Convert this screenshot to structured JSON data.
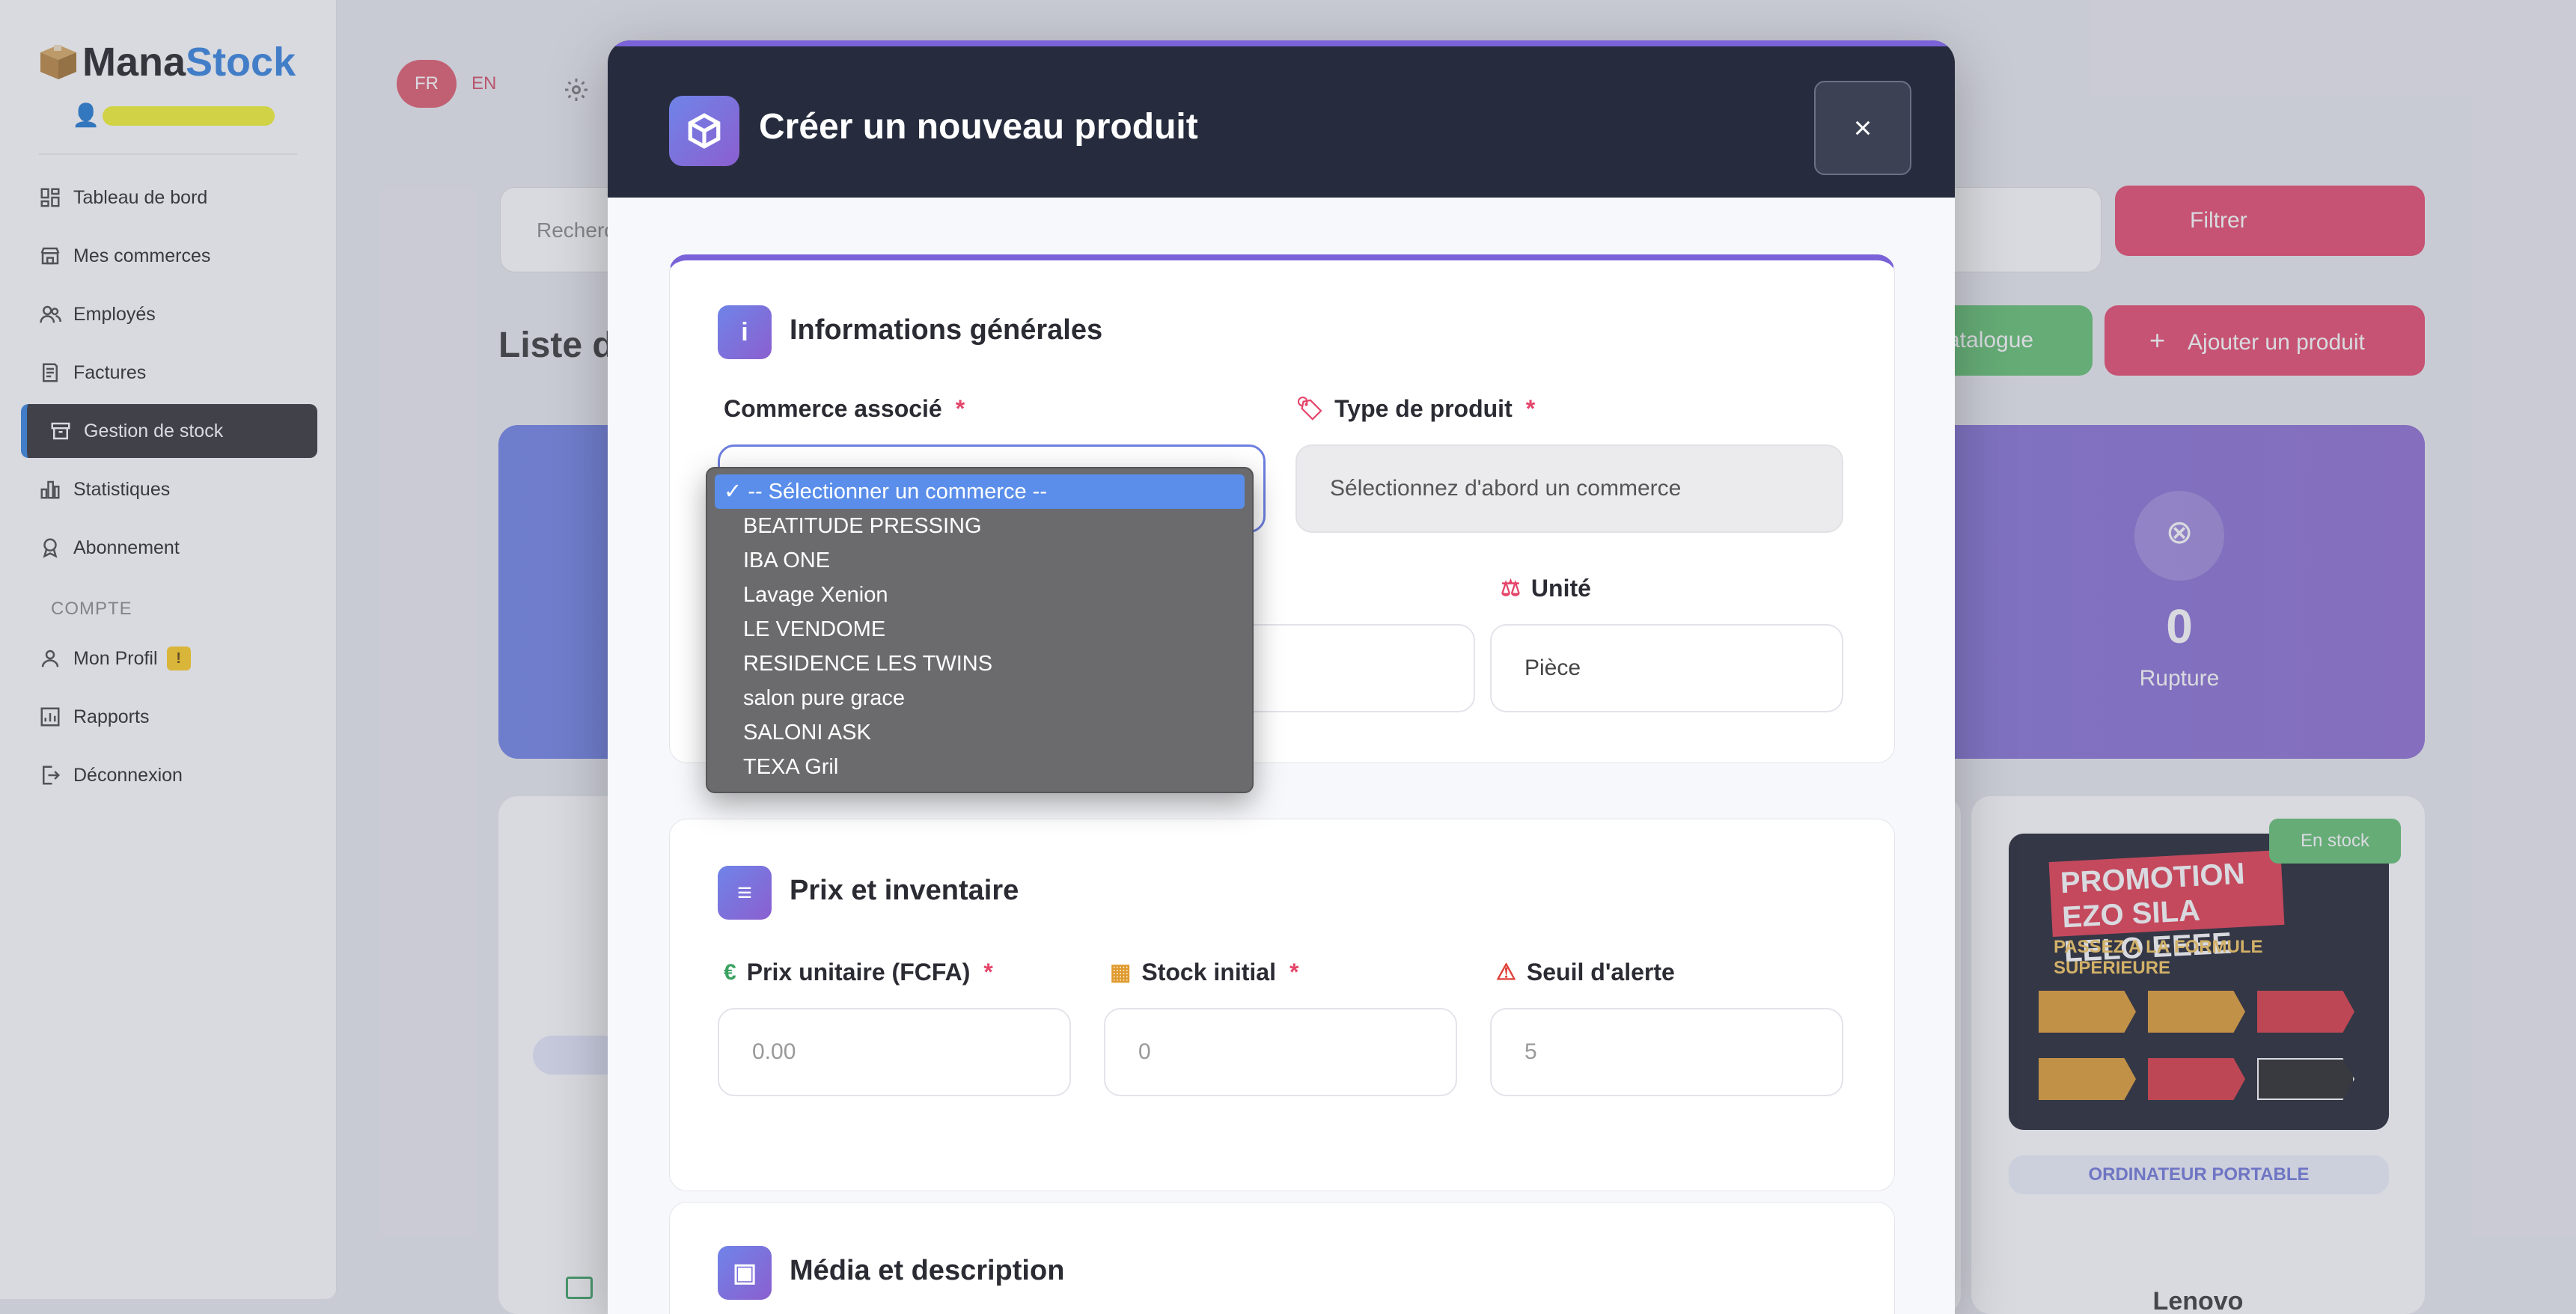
{
  "app": {
    "brand_part1": "Mana",
    "brand_part2": "Stock"
  },
  "sidebar": {
    "items": [
      {
        "label": "Tableau de bord"
      },
      {
        "label": "Mes commerces"
      },
      {
        "label": "Employés"
      },
      {
        "label": "Factures"
      },
      {
        "label": "Gestion de stock"
      },
      {
        "label": "Statistiques"
      },
      {
        "label": "Abonnement"
      }
    ],
    "account_section": "COMPTE",
    "account_items": [
      {
        "label": "Mon Profil",
        "badge": "!"
      },
      {
        "label": "Rapports"
      },
      {
        "label": "Déconnexion"
      }
    ]
  },
  "background": {
    "lang_fr": "FR",
    "lang_en": "EN",
    "search_placeholder": "Recherc",
    "filter_label": "Filtrer",
    "list_title": "Liste de",
    "catalog_label": "atalogue",
    "add_product_label": "Ajouter un produit",
    "stat_value": "0",
    "stat_label": "Rupture",
    "stock_badge": "En stock",
    "product_category": "ORDINATEUR PORTABLE",
    "product_name": "Lenovo",
    "promo_title": "PROMOTION EZO SILA LELO EEEE",
    "promo_subtitle": "PASSEZ A LA FORMULE SUPERIEURE"
  },
  "modal": {
    "title": "Créer un nouveau produit",
    "close_label": "×",
    "general_section": {
      "title": "Informations générales",
      "commerce_label": "Commerce associé",
      "type_label": "Type de produit",
      "type_value": "Sélectionnez d'abord un commerce",
      "unit_label": "Unité",
      "unit_value": "Pièce"
    },
    "price_section": {
      "title": "Prix et inventaire",
      "price_label": "Prix unitaire (FCFA)",
      "price_placeholder": "0.00",
      "stock_label": "Stock initial",
      "stock_placeholder": "0",
      "alert_label": "Seuil d'alerte",
      "alert_value": "5"
    },
    "media_section": {
      "title": "Média et description"
    },
    "required_mark": "*"
  },
  "dropdown": {
    "selected_mark": "✓",
    "options": [
      "-- Sélectionner un commerce --",
      "BEATITUDE PRESSING",
      "IBA ONE",
      "Lavage Xenion",
      "LE VENDOME",
      "RESIDENCE LES TWINS",
      "salon pure grace",
      "SALONI ASK",
      "TEXA Gril"
    ]
  },
  "colors": {
    "accent": "#7a63d8",
    "danger": "#e5456a",
    "brand_blue": "#2f7fe0",
    "dropdown_highlight": "#5a8eea"
  }
}
